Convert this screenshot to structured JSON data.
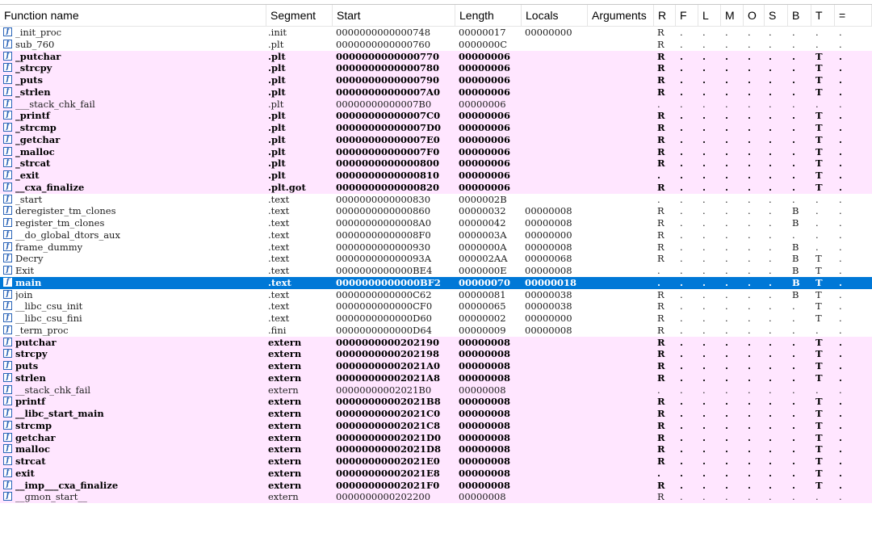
{
  "columns": [
    {
      "key": "name",
      "label": "Function name"
    },
    {
      "key": "segment",
      "label": "Segment"
    },
    {
      "key": "start",
      "label": "Start"
    },
    {
      "key": "length",
      "label": "Length"
    },
    {
      "key": "locals",
      "label": "Locals"
    },
    {
      "key": "arguments",
      "label": "Arguments"
    },
    {
      "key": "R",
      "label": "R"
    },
    {
      "key": "F",
      "label": "F"
    },
    {
      "key": "L",
      "label": "L"
    },
    {
      "key": "M",
      "label": "M"
    },
    {
      "key": "O",
      "label": "O"
    },
    {
      "key": "S",
      "label": "S"
    },
    {
      "key": "B",
      "label": "B"
    },
    {
      "key": "T",
      "label": "T"
    },
    {
      "key": "eq",
      "label": "="
    }
  ],
  "colors": {
    "library_row_bg": "#ffe6ff",
    "selected_row_bg": "#0078d7",
    "icon_color": "#2a64b8"
  },
  "icon": "function-icon",
  "rows": [
    {
      "name": "_init_proc",
      "segment": ".init",
      "start": "0000000000000748",
      "length": "00000017",
      "locals": "00000000",
      "arguments": "",
      "R": "R",
      "F": ".",
      "L": ".",
      "M": ".",
      "O": ".",
      "S": ".",
      "B": ".",
      "T": ".",
      "eq": ".",
      "style": "normal"
    },
    {
      "name": "sub_760",
      "segment": ".plt",
      "start": "0000000000000760",
      "length": "0000000C",
      "locals": "",
      "arguments": "",
      "R": "R",
      "F": ".",
      "L": ".",
      "M": ".",
      "O": ".",
      "S": ".",
      "B": ".",
      "T": ".",
      "eq": ".",
      "style": "normal"
    },
    {
      "name": "_putchar",
      "segment": ".plt",
      "start": "0000000000000770",
      "length": "00000006",
      "locals": "",
      "arguments": "",
      "R": "R",
      "F": ".",
      "L": ".",
      "M": ".",
      "O": ".",
      "S": ".",
      "B": ".",
      "T": "T",
      "eq": ".",
      "style": "lib"
    },
    {
      "name": "_strcpy",
      "segment": ".plt",
      "start": "0000000000000780",
      "length": "00000006",
      "locals": "",
      "arguments": "",
      "R": "R",
      "F": ".",
      "L": ".",
      "M": ".",
      "O": ".",
      "S": ".",
      "B": ".",
      "T": "T",
      "eq": ".",
      "style": "lib"
    },
    {
      "name": "_puts",
      "segment": ".plt",
      "start": "0000000000000790",
      "length": "00000006",
      "locals": "",
      "arguments": "",
      "R": "R",
      "F": ".",
      "L": ".",
      "M": ".",
      "O": ".",
      "S": ".",
      "B": ".",
      "T": "T",
      "eq": ".",
      "style": "lib"
    },
    {
      "name": "_strlen",
      "segment": ".plt",
      "start": "00000000000007A0",
      "length": "00000006",
      "locals": "",
      "arguments": "",
      "R": "R",
      "F": ".",
      "L": ".",
      "M": ".",
      "O": ".",
      "S": ".",
      "B": ".",
      "T": "T",
      "eq": ".",
      "style": "lib"
    },
    {
      "name": "___stack_chk_fail",
      "segment": ".plt",
      "start": "00000000000007B0",
      "length": "00000006",
      "locals": "",
      "arguments": "",
      "R": ".",
      "F": ".",
      "L": ".",
      "M": ".",
      "O": ".",
      "S": ".",
      "B": ".",
      "T": ".",
      "eq": ".",
      "style": "lib-light"
    },
    {
      "name": "_printf",
      "segment": ".plt",
      "start": "00000000000007C0",
      "length": "00000006",
      "locals": "",
      "arguments": "",
      "R": "R",
      "F": ".",
      "L": ".",
      "M": ".",
      "O": ".",
      "S": ".",
      "B": ".",
      "T": "T",
      "eq": ".",
      "style": "lib"
    },
    {
      "name": "_strcmp",
      "segment": ".plt",
      "start": "00000000000007D0",
      "length": "00000006",
      "locals": "",
      "arguments": "",
      "R": "R",
      "F": ".",
      "L": ".",
      "M": ".",
      "O": ".",
      "S": ".",
      "B": ".",
      "T": "T",
      "eq": ".",
      "style": "lib"
    },
    {
      "name": "_getchar",
      "segment": ".plt",
      "start": "00000000000007E0",
      "length": "00000006",
      "locals": "",
      "arguments": "",
      "R": "R",
      "F": ".",
      "L": ".",
      "M": ".",
      "O": ".",
      "S": ".",
      "B": ".",
      "T": "T",
      "eq": ".",
      "style": "lib"
    },
    {
      "name": "_malloc",
      "segment": ".plt",
      "start": "00000000000007F0",
      "length": "00000006",
      "locals": "",
      "arguments": "",
      "R": "R",
      "F": ".",
      "L": ".",
      "M": ".",
      "O": ".",
      "S": ".",
      "B": ".",
      "T": "T",
      "eq": ".",
      "style": "lib"
    },
    {
      "name": "_strcat",
      "segment": ".plt",
      "start": "0000000000000800",
      "length": "00000006",
      "locals": "",
      "arguments": "",
      "R": "R",
      "F": ".",
      "L": ".",
      "M": ".",
      "O": ".",
      "S": ".",
      "B": ".",
      "T": "T",
      "eq": ".",
      "style": "lib"
    },
    {
      "name": "_exit",
      "segment": ".plt",
      "start": "0000000000000810",
      "length": "00000006",
      "locals": "",
      "arguments": "",
      "R": ".",
      "F": ".",
      "L": ".",
      "M": ".",
      "O": ".",
      "S": ".",
      "B": ".",
      "T": "T",
      "eq": ".",
      "style": "lib"
    },
    {
      "name": "__cxa_finalize",
      "segment": ".plt.got",
      "start": "0000000000000820",
      "length": "00000006",
      "locals": "",
      "arguments": "",
      "R": "R",
      "F": ".",
      "L": ".",
      "M": ".",
      "O": ".",
      "S": ".",
      "B": ".",
      "T": "T",
      "eq": ".",
      "style": "lib"
    },
    {
      "name": "_start",
      "segment": ".text",
      "start": "0000000000000830",
      "length": "0000002B",
      "locals": "",
      "arguments": "",
      "R": ".",
      "F": ".",
      "L": ".",
      "M": ".",
      "O": ".",
      "S": ".",
      "B": ".",
      "T": ".",
      "eq": ".",
      "style": "normal"
    },
    {
      "name": "deregister_tm_clones",
      "segment": ".text",
      "start": "0000000000000860",
      "length": "00000032",
      "locals": "00000008",
      "arguments": "",
      "R": "R",
      "F": ".",
      "L": ".",
      "M": ".",
      "O": ".",
      "S": ".",
      "B": "B",
      "T": ".",
      "eq": ".",
      "style": "normal"
    },
    {
      "name": "register_tm_clones",
      "segment": ".text",
      "start": "00000000000008A0",
      "length": "00000042",
      "locals": "00000008",
      "arguments": "",
      "R": "R",
      "F": ".",
      "L": ".",
      "M": ".",
      "O": ".",
      "S": ".",
      "B": "B",
      "T": ".",
      "eq": ".",
      "style": "normal"
    },
    {
      "name": "__do_global_dtors_aux",
      "segment": ".text",
      "start": "00000000000008F0",
      "length": "0000003A",
      "locals": "00000000",
      "arguments": "",
      "R": "R",
      "F": ".",
      "L": ".",
      "M": ".",
      "O": ".",
      "S": ".",
      "B": ".",
      "T": ".",
      "eq": ".",
      "style": "normal"
    },
    {
      "name": "frame_dummy",
      "segment": ".text",
      "start": "0000000000000930",
      "length": "0000000A",
      "locals": "00000008",
      "arguments": "",
      "R": "R",
      "F": ".",
      "L": ".",
      "M": ".",
      "O": ".",
      "S": ".",
      "B": "B",
      "T": ".",
      "eq": ".",
      "style": "normal"
    },
    {
      "name": "Decry",
      "segment": ".text",
      "start": "000000000000093A",
      "length": "000002AA",
      "locals": "00000068",
      "arguments": "",
      "R": "R",
      "F": ".",
      "L": ".",
      "M": ".",
      "O": ".",
      "S": ".",
      "B": "B",
      "T": "T",
      "eq": ".",
      "style": "normal"
    },
    {
      "name": "Exit",
      "segment": ".text",
      "start": "0000000000000BE4",
      "length": "0000000E",
      "locals": "00000008",
      "arguments": "",
      "R": ".",
      "F": ".",
      "L": ".",
      "M": ".",
      "O": ".",
      "S": ".",
      "B": "B",
      "T": "T",
      "eq": ".",
      "style": "normal"
    },
    {
      "name": "main",
      "segment": ".text",
      "start": "0000000000000BF2",
      "length": "00000070",
      "locals": "00000018",
      "arguments": "",
      "R": ".",
      "F": ".",
      "L": ".",
      "M": ".",
      "O": ".",
      "S": ".",
      "B": "B",
      "T": "T",
      "eq": ".",
      "style": "selected"
    },
    {
      "name": "join",
      "segment": ".text",
      "start": "0000000000000C62",
      "length": "00000081",
      "locals": "00000038",
      "arguments": "",
      "R": "R",
      "F": ".",
      "L": ".",
      "M": ".",
      "O": ".",
      "S": ".",
      "B": "B",
      "T": "T",
      "eq": ".",
      "style": "normal"
    },
    {
      "name": "__libc_csu_init",
      "segment": ".text",
      "start": "0000000000000CF0",
      "length": "00000065",
      "locals": "00000038",
      "arguments": "",
      "R": "R",
      "F": ".",
      "L": ".",
      "M": ".",
      "O": ".",
      "S": ".",
      "B": ".",
      "T": "T",
      "eq": ".",
      "style": "normal"
    },
    {
      "name": "__libc_csu_fini",
      "segment": ".text",
      "start": "0000000000000D60",
      "length": "00000002",
      "locals": "00000000",
      "arguments": "",
      "R": "R",
      "F": ".",
      "L": ".",
      "M": ".",
      "O": ".",
      "S": ".",
      "B": ".",
      "T": "T",
      "eq": ".",
      "style": "normal"
    },
    {
      "name": "_term_proc",
      "segment": ".fini",
      "start": "0000000000000D64",
      "length": "00000009",
      "locals": "00000008",
      "arguments": "",
      "R": "R",
      "F": ".",
      "L": ".",
      "M": ".",
      "O": ".",
      "S": ".",
      "B": ".",
      "T": ".",
      "eq": ".",
      "style": "normal"
    },
    {
      "name": "putchar",
      "segment": "extern",
      "start": "0000000000202190",
      "length": "00000008",
      "locals": "",
      "arguments": "",
      "R": "R",
      "F": ".",
      "L": ".",
      "M": ".",
      "O": ".",
      "S": ".",
      "B": ".",
      "T": "T",
      "eq": ".",
      "style": "lib"
    },
    {
      "name": "strcpy",
      "segment": "extern",
      "start": "0000000000202198",
      "length": "00000008",
      "locals": "",
      "arguments": "",
      "R": "R",
      "F": ".",
      "L": ".",
      "M": ".",
      "O": ".",
      "S": ".",
      "B": ".",
      "T": "T",
      "eq": ".",
      "style": "lib"
    },
    {
      "name": "puts",
      "segment": "extern",
      "start": "00000000002021A0",
      "length": "00000008",
      "locals": "",
      "arguments": "",
      "R": "R",
      "F": ".",
      "L": ".",
      "M": ".",
      "O": ".",
      "S": ".",
      "B": ".",
      "T": "T",
      "eq": ".",
      "style": "lib"
    },
    {
      "name": "strlen",
      "segment": "extern",
      "start": "00000000002021A8",
      "length": "00000008",
      "locals": "",
      "arguments": "",
      "R": "R",
      "F": ".",
      "L": ".",
      "M": ".",
      "O": ".",
      "S": ".",
      "B": ".",
      "T": "T",
      "eq": ".",
      "style": "lib"
    },
    {
      "name": "__stack_chk_fail",
      "segment": "extern",
      "start": "00000000002021B0",
      "length": "00000008",
      "locals": "",
      "arguments": "",
      "R": ".",
      "F": ".",
      "L": ".",
      "M": ".",
      "O": ".",
      "S": ".",
      "B": ".",
      "T": ".",
      "eq": ".",
      "style": "lib-light"
    },
    {
      "name": "printf",
      "segment": "extern",
      "start": "00000000002021B8",
      "length": "00000008",
      "locals": "",
      "arguments": "",
      "R": "R",
      "F": ".",
      "L": ".",
      "M": ".",
      "O": ".",
      "S": ".",
      "B": ".",
      "T": "T",
      "eq": ".",
      "style": "lib"
    },
    {
      "name": "__libc_start_main",
      "segment": "extern",
      "start": "00000000002021C0",
      "length": "00000008",
      "locals": "",
      "arguments": "",
      "R": "R",
      "F": ".",
      "L": ".",
      "M": ".",
      "O": ".",
      "S": ".",
      "B": ".",
      "T": "T",
      "eq": ".",
      "style": "lib"
    },
    {
      "name": "strcmp",
      "segment": "extern",
      "start": "00000000002021C8",
      "length": "00000008",
      "locals": "",
      "arguments": "",
      "R": "R",
      "F": ".",
      "L": ".",
      "M": ".",
      "O": ".",
      "S": ".",
      "B": ".",
      "T": "T",
      "eq": ".",
      "style": "lib"
    },
    {
      "name": "getchar",
      "segment": "extern",
      "start": "00000000002021D0",
      "length": "00000008",
      "locals": "",
      "arguments": "",
      "R": "R",
      "F": ".",
      "L": ".",
      "M": ".",
      "O": ".",
      "S": ".",
      "B": ".",
      "T": "T",
      "eq": ".",
      "style": "lib"
    },
    {
      "name": "malloc",
      "segment": "extern",
      "start": "00000000002021D8",
      "length": "00000008",
      "locals": "",
      "arguments": "",
      "R": "R",
      "F": ".",
      "L": ".",
      "M": ".",
      "O": ".",
      "S": ".",
      "B": ".",
      "T": "T",
      "eq": ".",
      "style": "lib"
    },
    {
      "name": "strcat",
      "segment": "extern",
      "start": "00000000002021E0",
      "length": "00000008",
      "locals": "",
      "arguments": "",
      "R": "R",
      "F": ".",
      "L": ".",
      "M": ".",
      "O": ".",
      "S": ".",
      "B": ".",
      "T": "T",
      "eq": ".",
      "style": "lib"
    },
    {
      "name": "exit",
      "segment": "extern",
      "start": "00000000002021E8",
      "length": "00000008",
      "locals": "",
      "arguments": "",
      "R": ".",
      "F": ".",
      "L": ".",
      "M": ".",
      "O": ".",
      "S": ".",
      "B": ".",
      "T": "T",
      "eq": ".",
      "style": "lib"
    },
    {
      "name": "__imp___cxa_finalize",
      "segment": "extern",
      "start": "00000000002021F0",
      "length": "00000008",
      "locals": "",
      "arguments": "",
      "R": "R",
      "F": ".",
      "L": ".",
      "M": ".",
      "O": ".",
      "S": ".",
      "B": ".",
      "T": "T",
      "eq": ".",
      "style": "lib"
    },
    {
      "name": "__gmon_start__",
      "segment": "extern",
      "start": "0000000000202200",
      "length": "00000008",
      "locals": "",
      "arguments": "",
      "R": "R",
      "F": ".",
      "L": ".",
      "M": ".",
      "O": ".",
      "S": ".",
      "B": ".",
      "T": ".",
      "eq": ".",
      "style": "lib-light"
    }
  ]
}
